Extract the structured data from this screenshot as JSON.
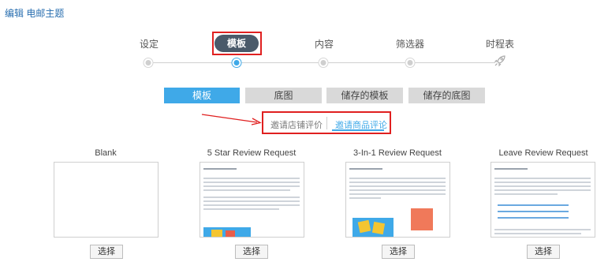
{
  "page": {
    "title": "编辑 电邮主题"
  },
  "wizard": {
    "steps": [
      {
        "label": "设定",
        "active": false
      },
      {
        "label": "模板",
        "active": true
      },
      {
        "label": "内容",
        "active": false
      },
      {
        "label": "筛选器",
        "active": false
      },
      {
        "label": "时程表",
        "active": false
      }
    ],
    "final_icon": "rocket-icon"
  },
  "main_tabs": [
    {
      "label": "模板",
      "active": true
    },
    {
      "label": "底图",
      "active": false
    },
    {
      "label": "储存的模板",
      "active": false
    },
    {
      "label": "储存的底图",
      "active": false
    }
  ],
  "sub_tabs": [
    {
      "label": "邀请店铺评价",
      "active": false
    },
    {
      "label": "邀请商品评论",
      "active": true
    }
  ],
  "templates": [
    {
      "title": "Blank",
      "button": "选择"
    },
    {
      "title": "5 Star Review Request",
      "button": "选择"
    },
    {
      "title": "3-In-1 Review Request",
      "button": "选择"
    },
    {
      "title": "Leave Review Request",
      "button": "选择"
    }
  ],
  "colors": {
    "accent": "#3fa9e8",
    "highlight": "#e02020",
    "inactive_tab": "#d9d9d9",
    "title_blue": "#2a6fb0"
  }
}
